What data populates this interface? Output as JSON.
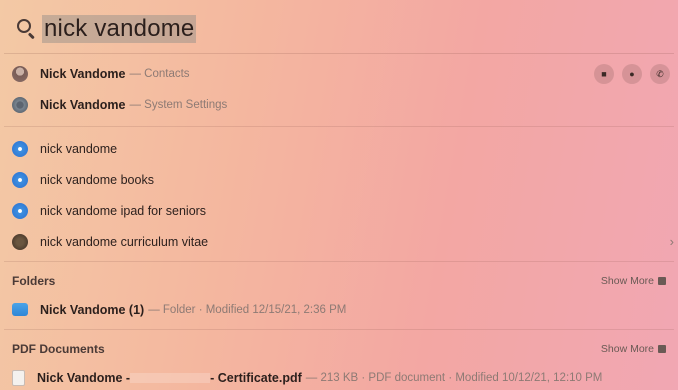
{
  "search": {
    "query": "nick vandome"
  },
  "top_hits": [
    {
      "title": "Nick Vandome",
      "subtitle": "— Contacts",
      "icon": "contact-icon"
    },
    {
      "title": "Nick Vandome",
      "subtitle": "— System Settings",
      "icon": "settings-icon"
    }
  ],
  "contact_actions": [
    {
      "name": "video-call-icon",
      "glyph": "■"
    },
    {
      "name": "message-icon",
      "glyph": "●"
    },
    {
      "name": "phone-icon",
      "glyph": "✆"
    }
  ],
  "suggestions": [
    {
      "text": "nick vandome",
      "icon": "safari-icon"
    },
    {
      "text": "nick vandome books",
      "icon": "safari-icon"
    },
    {
      "text": "nick vandome ipad for seniors",
      "icon": "safari-icon"
    },
    {
      "text": "nick vandome curriculum vitae",
      "icon": "books-icon"
    }
  ],
  "suggestion_chevron": "›",
  "folders": {
    "header": "Folders",
    "show_more": "Show More",
    "items": [
      {
        "title": "Nick Vandome (1)",
        "subtitle": "— Folder · Modified 12/15/21, 2:36 PM"
      }
    ]
  },
  "pdf_documents": {
    "header": "PDF Documents",
    "show_more": "Show More",
    "items": [
      {
        "title_start": "Nick Vandome -",
        "title_end": "- Certificate.pdf",
        "subtitle": "— 213 KB · PDF document · Modified 10/12/21, 12:10 PM"
      }
    ]
  }
}
